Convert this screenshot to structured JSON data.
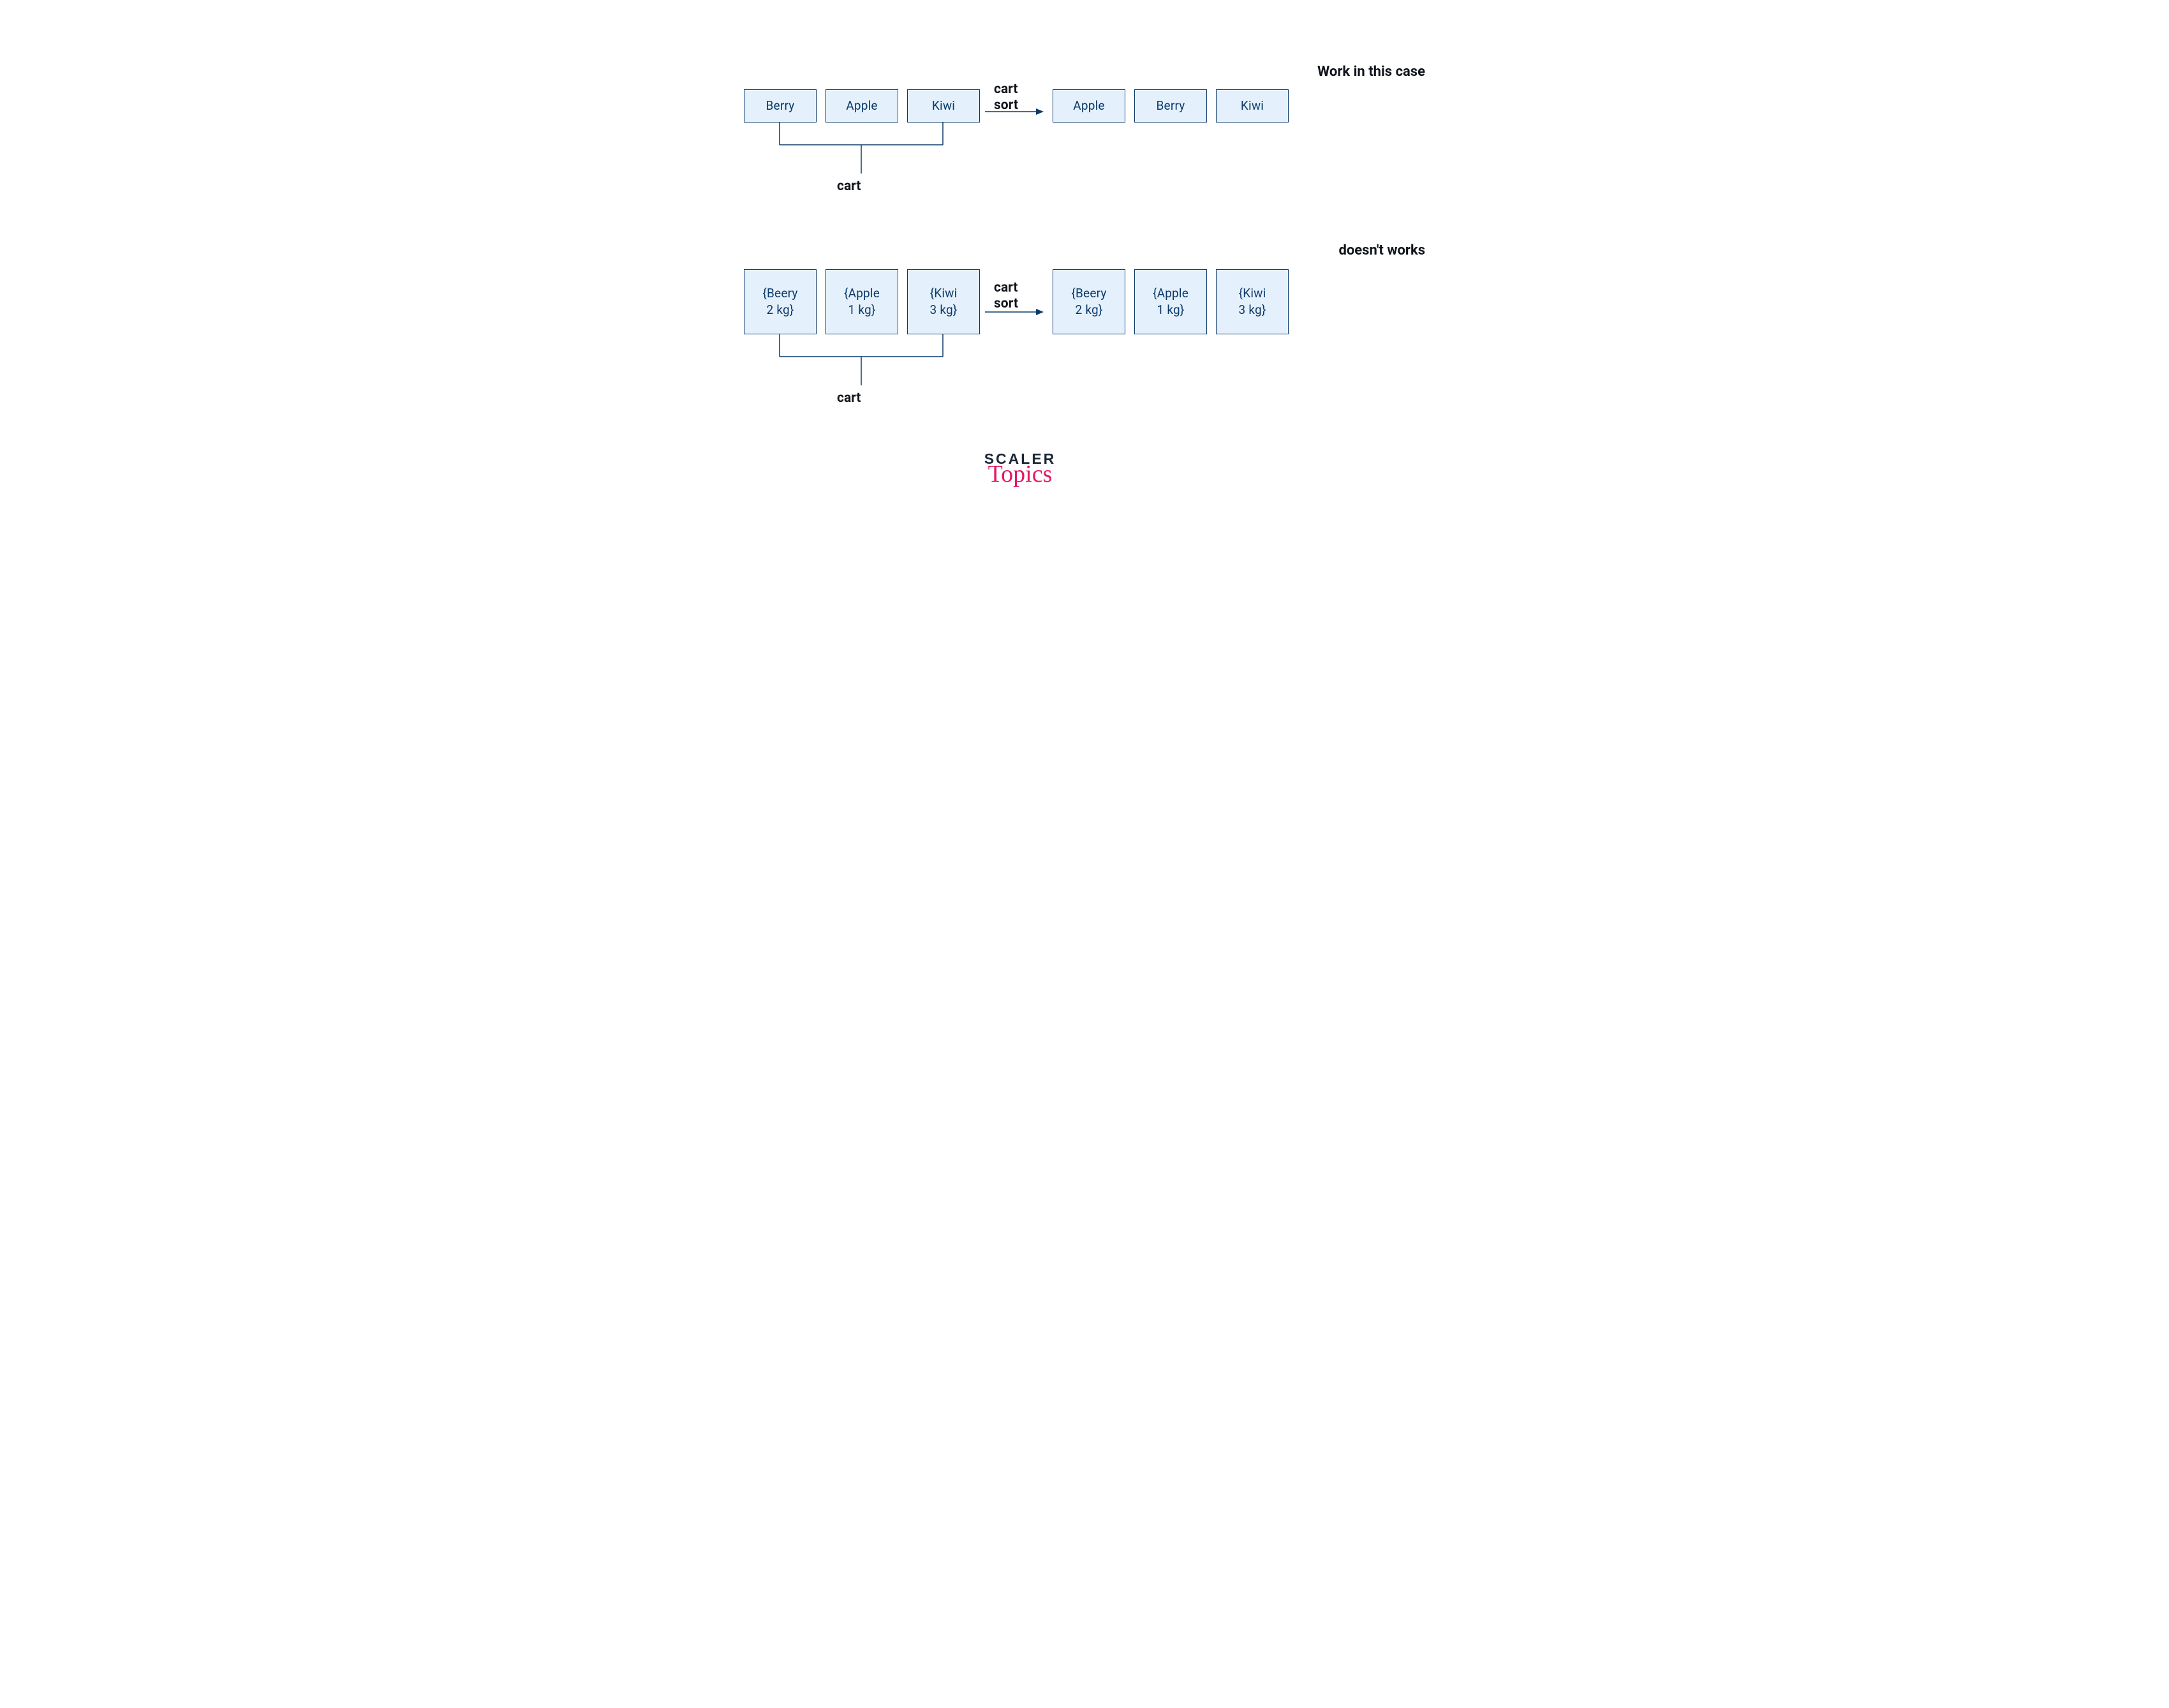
{
  "row1": {
    "heading": "Work in this case",
    "leftBoxes": [
      "Berry",
      "Apple",
      "Kiwi"
    ],
    "rightBoxes": [
      "Apple",
      "Berry",
      "Kiwi"
    ],
    "arrowTop": "cart",
    "arrowBottom": "sort",
    "bracketLabel": "cart"
  },
  "row2": {
    "heading": "doesn't works",
    "leftBoxes": [
      "{Beery\n2 kg}",
      "{Apple\n1 kg}",
      "{Kiwi\n3 kg}"
    ],
    "rightBoxes": [
      "{Beery\n2 kg}",
      "{Apple\n1 kg}",
      "{Kiwi\n3 kg}"
    ],
    "arrowTop": "cart",
    "arrowBottom": "sort",
    "bracketLabel": "cart"
  },
  "logo": {
    "line1": "SCALER",
    "line2": "Topics"
  }
}
